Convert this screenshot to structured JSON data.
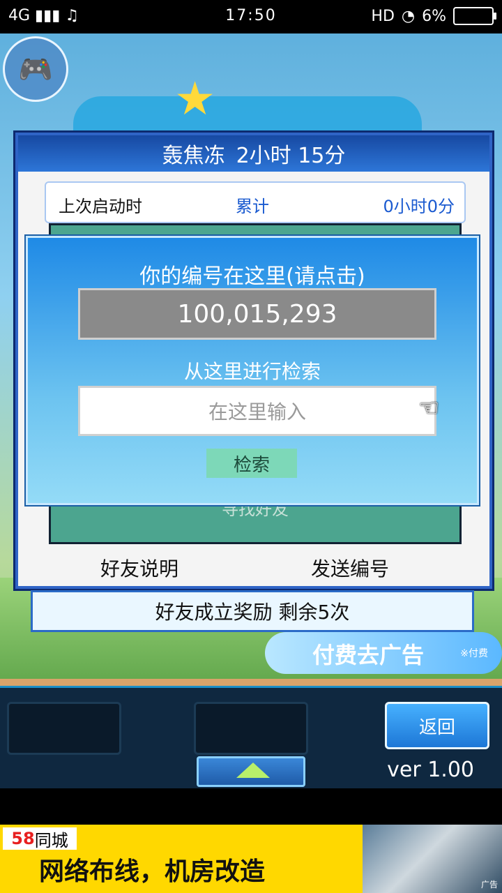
{
  "status_bar": {
    "network": "4G",
    "time": "17:50",
    "hd": "HD",
    "battery": "6%"
  },
  "game": {
    "timer_header": {
      "label": "轰焦冻",
      "time": "2小时 15分"
    },
    "info": {
      "last_launch": "上次启动时",
      "cumulative_label": "累计",
      "cumulative_value": "0小时0分"
    },
    "dialog": {
      "title": "你的编号在这里(请点击)",
      "id_number": "100,015,293",
      "search_prompt": "从这里进行检索",
      "input_placeholder": "在这里输入",
      "search_button": "检索"
    },
    "teal_hint": "寻找好友",
    "footer_left": "好友说明",
    "footer_right": "发送编号",
    "reward_text": "好友成立奖励 剩余5次",
    "ad_strip": {
      "text": "付费去广告",
      "small": "※付费"
    },
    "back_button": "返回",
    "version": "ver 1.00"
  },
  "bottom_ad": {
    "logo_num": "58",
    "logo_text": "同城",
    "headline": "网络布线，机房改造",
    "tag": "广告"
  }
}
